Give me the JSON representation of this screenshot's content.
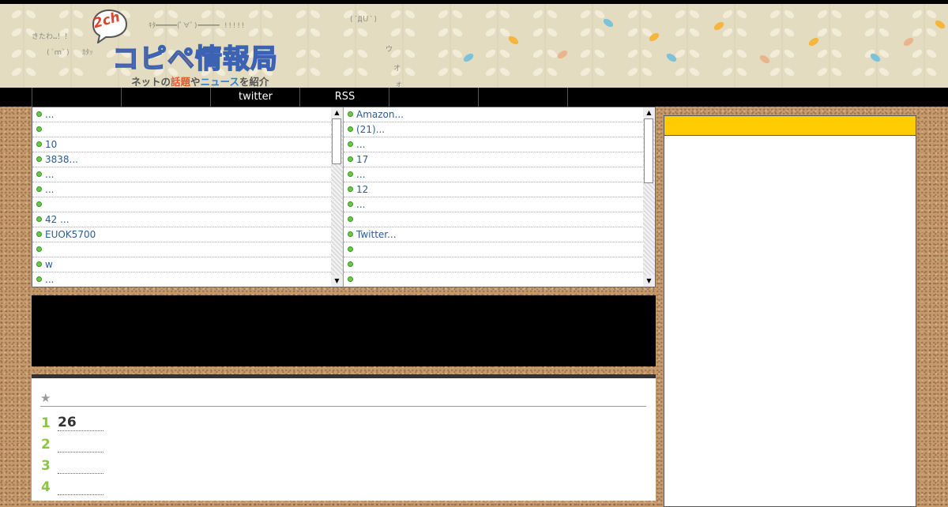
{
  "header": {
    "logo_badge": "2ch",
    "logo_title": "コピペ情報局",
    "logo_tagline": [
      "ネットの",
      "話題",
      "や",
      "ニュース",
      "を紹介"
    ],
    "ascii_art": [
      "ｷﾀ━━━━━(ﾟ∀ﾟ)━━━━━ !!!!!",
      "きたわ…！！",
      "(´ｍ`)",
      "ｶﾀｯ",
      "(´ДＵ`)",
      "ウ",
      "オ",
      "ォ"
    ]
  },
  "nav": {
    "items": [
      "",
      "",
      "twitter",
      "RSS",
      "",
      "",
      ""
    ]
  },
  "links": {
    "left": [
      "...",
      "",
      "10",
      "3838...",
      "...",
      "...",
      "",
      "42 ...",
      "EUOK5700",
      "",
      " w",
      "..."
    ],
    "right": [
      "Amazon...",
      "(21)...",
      "...",
      "17",
      "...",
      "12",
      "...",
      "",
      "Twitter...",
      "",
      "",
      ""
    ]
  },
  "ranking": {
    "header_icon": "star-icon",
    "items": [
      {
        "rank": "1",
        "text": "26"
      },
      {
        "rank": "2",
        "text": ""
      },
      {
        "rank": "3",
        "text": ""
      },
      {
        "rank": "4",
        "text": ""
      }
    ]
  },
  "colors": {
    "accent_yellow": "#ffcc00",
    "rank_green": "#8cc63f",
    "link_blue": "#2a5c93",
    "nav_black": "#000000"
  }
}
